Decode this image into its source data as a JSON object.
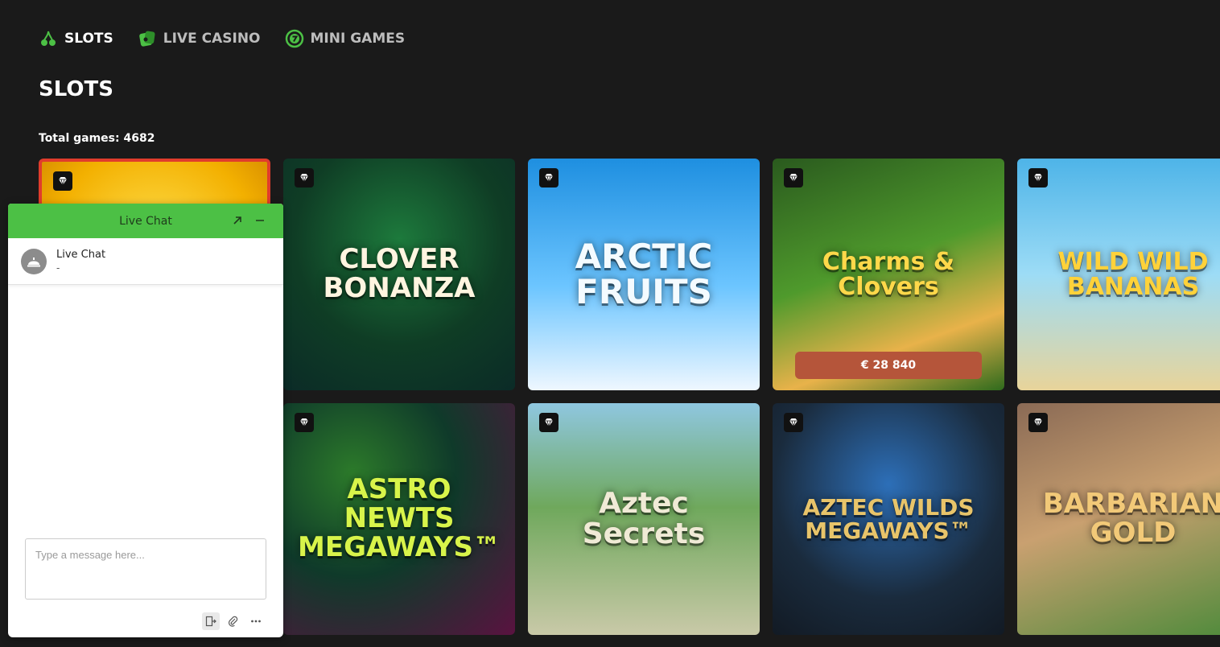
{
  "nav": {
    "items": [
      {
        "label": "SLOTS",
        "icon": "cherry-icon",
        "active": true
      },
      {
        "label": "LIVE CASINO",
        "icon": "casino-chip-icon",
        "active": false
      },
      {
        "label": "MINI GAMES",
        "icon": "seven-coin-icon",
        "active": false
      }
    ]
  },
  "page": {
    "title": "SLOTS",
    "total_games": "Total games: 4682"
  },
  "colors": {
    "accent": "#4cc045",
    "background": "#1a1a1a",
    "jackpot": "#b5553a"
  },
  "games": [
    {
      "name": ""
    },
    {
      "name": "CLOVER BONANZA"
    },
    {
      "name": "ARCTIC FRUITS"
    },
    {
      "name": "Charms & Clovers",
      "jackpot": "€ 28 840"
    },
    {
      "name": "WILD WILD BANANAS"
    },
    {
      "name": ""
    },
    {
      "name": "ASTRO NEWTS MEGAWAYS™"
    },
    {
      "name": "Aztec Secrets"
    },
    {
      "name": "AZTEC WILDS MEGAWAYS™"
    },
    {
      "name": "BARBARIAN GOLD"
    }
  ],
  "chat": {
    "header_title": "Live Chat",
    "conversation": {
      "name": "Live Chat",
      "preview": "-"
    },
    "input_placeholder": "Type a message here...",
    "tool_icons": [
      "exit-icon",
      "paperclip-icon",
      "more-icon"
    ]
  }
}
